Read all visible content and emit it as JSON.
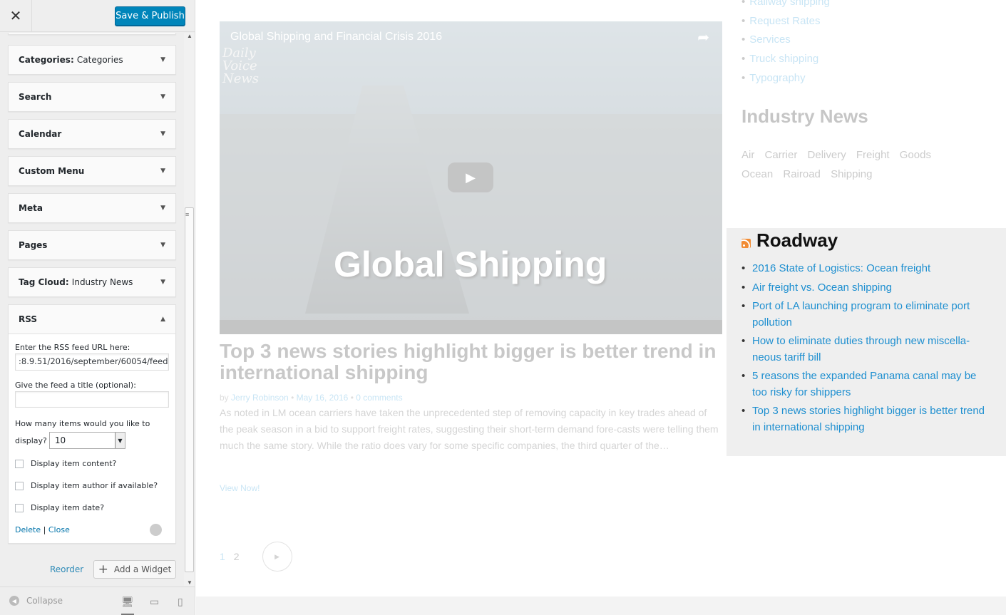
{
  "header": {
    "close_label": "✕",
    "publish_label": "Save & Publish"
  },
  "widgets": [
    {
      "name": "Categories",
      "sub": "Categories"
    },
    {
      "name": "Search",
      "sub": ""
    },
    {
      "name": "Calendar",
      "sub": ""
    },
    {
      "name": "Custom Menu",
      "sub": ""
    },
    {
      "name": "Meta",
      "sub": ""
    },
    {
      "name": "Pages",
      "sub": ""
    },
    {
      "name": "Tag Cloud",
      "sub": "Industry News"
    }
  ],
  "rss_widget": {
    "name": "RSS",
    "url_label": "Enter the RSS feed URL here:",
    "url_value": ":8.9.51/2016/september/60054/feed",
    "title_label": "Give the feed a title (optional):",
    "title_value": "",
    "items_label_1": "How many items would you like to",
    "items_label_2": "display?",
    "items_value": "10",
    "opt_content": "Display item content?",
    "opt_author": "Display item author if available?",
    "opt_date": "Display item date?",
    "delete_label": "Delete",
    "separator": "|",
    "close_label": "Close"
  },
  "bottom": {
    "reorder_label": "Reorder",
    "add_widget_label": "Add a Widget"
  },
  "footer": {
    "collapse_label": "Collapse"
  },
  "preview": {
    "video_title": "Global Shipping and Financial Crisis 2016",
    "video_caption": "Global Shipping",
    "video_logo": "Daily Voice News",
    "post_title": "Top 3 news stories highlight bigger is better trend in international shipping",
    "meta_by": "by",
    "meta_author": "Jerry Robinson",
    "meta_dot": "•",
    "meta_date": "May 16, 2016",
    "meta_comments": "0 comments",
    "excerpt": "As noted in LM ocean carriers have taken the unprecedented step of removing capacity in key trades ahead of the peak season in a bid to support freight rates, suggesting their short-term demand fore-casts were telling them much the same story. While the ratio does vary for some specific companies, the third quarter of the…",
    "view_now": "View Now!",
    "page_1": "1",
    "page_2": "2",
    "categories": [
      "Railway shipping",
      "Request Rates",
      "Services",
      "Truck shipping",
      "Typography"
    ],
    "industry_title": "Industry News",
    "tags": [
      "Air",
      "Carrier",
      "Delivery",
      "Freight",
      "Goods",
      "Ocean",
      "Rairoad",
      "Shipping"
    ],
    "roadway_title": "Roadway",
    "roadway_items": [
      "2016 State of Logistics: Ocean freight",
      "Air freight vs. Ocean shipping",
      "Port of LA launching program to eliminate port pollution",
      "How to eliminate duties through new miscella-neous tariff bill",
      "5 reasons the expanded Panama canal may be too risky for shippers",
      "Top 3 news stories highlight bigger is better trend in international shipping"
    ]
  },
  "colors": {
    "publish": "#0085ba",
    "link": "#1e8fd0",
    "rss": "#f18c35"
  }
}
